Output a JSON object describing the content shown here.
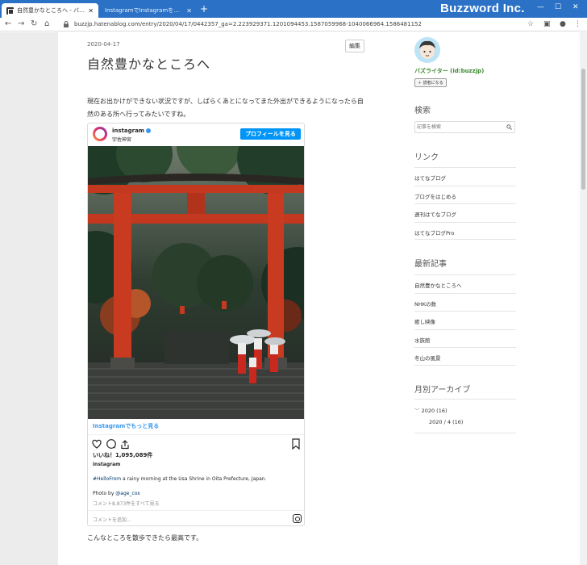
{
  "browser": {
    "tabs": [
      {
        "title": "自然豊かなところへ - バズお出かけ",
        "active": true
      },
      {
        "title": "InstagramでInstagramを利用して...",
        "active": false
      }
    ],
    "url": "buzzjp.hatenablog.com/entry/2020/04/17/0442357_ga=2.223929371.1201094453.1587059968-1040066964.1586481152",
    "brand": "Buzzword Inc."
  },
  "post": {
    "date": "2020-04-17",
    "edit_label": "編集",
    "title": "自然豊かなところへ",
    "intro": "現在お出かけができない状況ですが、しばらくあとになってまた外出ができるようになったら自然のある所へ行ってみたいですね。",
    "outro": "こんなところを散歩できたら最高です。"
  },
  "instagram": {
    "account": "instagram",
    "location": "宇佐神宮",
    "follow_label": "プロフィールを見る",
    "more_label": "Instagramでもっと見る",
    "likes": "いいね！1,095,089件",
    "username": "instagram",
    "caption_tag": "#HelloFrom",
    "caption_text": " a rainy morning at the Usa Shrine in Oita Prefecture, Japan.",
    "photo_by": "Photo by ",
    "photo_by_user": "@age_cox",
    "comments": "コメント8,873件をすべて見る",
    "add_comment": "コメントを追加..."
  },
  "sidebar": {
    "user": "バズライター (id:buzzjp)",
    "reader_label": "読者になる",
    "search_heading": "検索",
    "search_placeholder": "記事を検索",
    "links_heading": "リンク",
    "links": [
      "はてなブログ",
      "ブログをはじめる",
      "週刊はてなブログ",
      "はてなブログPro"
    ],
    "recent_heading": "最新記事",
    "recent": [
      "自然豊かなところへ",
      "NHKの数",
      "癒し映像",
      "水族館",
      "冬山の風景"
    ],
    "archive_heading": "月別アーカイブ",
    "archive_year": "2020 (16)",
    "archive_month": "2020 / 4 (16)"
  }
}
